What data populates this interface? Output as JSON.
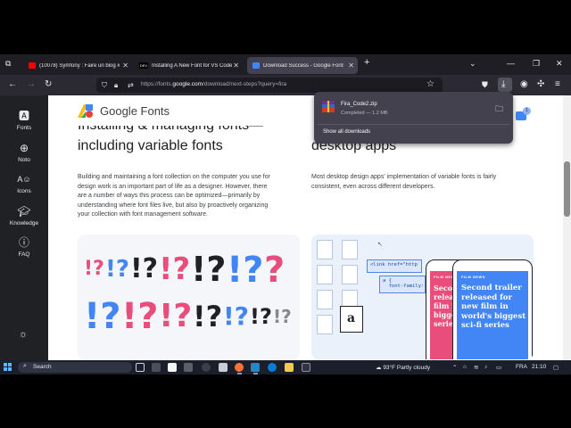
{
  "browser": {
    "tabs": [
      {
        "title": "(10078) Symfony : Faire un blog #4",
        "favicon_color": "#ff0000",
        "active": false
      },
      {
        "title": "Installing A New Font for VS Code",
        "favicon_text": "DEV",
        "active": false
      },
      {
        "title": "Download Success - Google Fonts",
        "favicon_color": "#4285f4",
        "active": true
      }
    ],
    "new_tab_label": "+",
    "url": {
      "prefix": "https://fonts.",
      "domain": "google.com",
      "path": "/download/next-steps?query=fira"
    }
  },
  "downloads": {
    "file_name": "Fira_Code2.zip",
    "status": "Completed — 1.2 MB",
    "show_all_label": "Show all downloads",
    "badge_count": "1"
  },
  "sidebar": {
    "items": [
      {
        "label": "Fonts",
        "icon": "fonts-icon"
      },
      {
        "label": "Noto",
        "icon": "globe-icon"
      },
      {
        "label": "Icons",
        "icon": "icons-icon"
      },
      {
        "label": "Knowledge",
        "icon": "graduation-cap-icon"
      },
      {
        "label": "FAQ",
        "icon": "help-circle-icon"
      }
    ]
  },
  "page": {
    "brand": "Google Fonts",
    "left": {
      "heading_line1": "Installing & managing fonts—",
      "heading_line2": "including variable fonts",
      "body": [
        "Building and maintaining a font collection on the computer you use for",
        "design work is an important part of life as a designer. However, there",
        "are a number of ways this process can be optimized—primarily by",
        "understanding where font files live, but also by proactively organizing",
        "your collection with font management software."
      ]
    },
    "right": {
      "heading_line2": "desktop apps",
      "body": [
        "Most desktop design apps' implementation of variable fonts is fairly",
        "consistent, even across different developers."
      ]
    },
    "card_right": {
      "code_line1": "<link href=\"http",
      "code_line2": "a {",
      "code_line3": "  font-family:",
      "doc_glyph": "a",
      "film_news_label": "FILM NEWS",
      "headline_partial": [
        "Second",
        "releas",
        "film i",
        "bigge",
        "serie"
      ],
      "headline_full": [
        "Second trailer",
        "released for",
        "new film in",
        "world's biggest",
        "sci-fi series"
      ]
    }
  },
  "taskbar": {
    "search_label": "Search",
    "weather": "93°F  Partly cloudy",
    "language": "FRA",
    "time": "21:10"
  }
}
